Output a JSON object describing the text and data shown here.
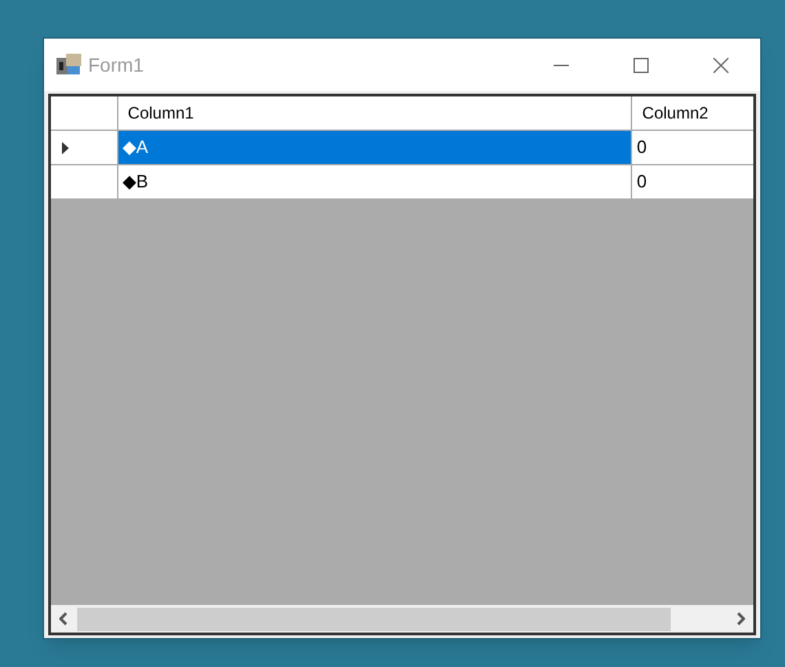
{
  "window": {
    "title": "Form1"
  },
  "grid": {
    "columns": [
      "Column1",
      "Column2"
    ],
    "rows": [
      {
        "cells": [
          "◆A",
          "0"
        ],
        "selected": true,
        "current": true
      },
      {
        "cells": [
          "◆B",
          "0"
        ],
        "selected": false,
        "current": false
      }
    ]
  }
}
